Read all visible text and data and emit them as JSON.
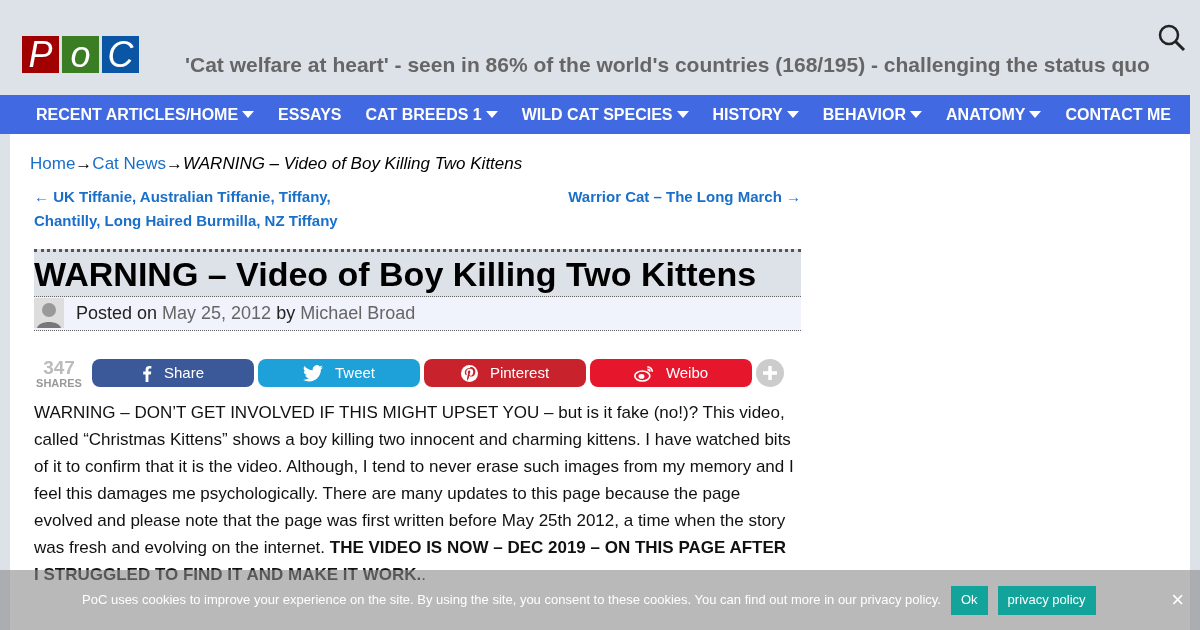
{
  "header": {
    "logo_letters": [
      "P",
      "o",
      "C"
    ],
    "tagline": "'Cat welfare at heart' - seen in 86% of the world's countries (168/195) - challenging the status quo"
  },
  "nav": [
    {
      "label": "RECENT ARTICLES/HOME",
      "has_submenu": true
    },
    {
      "label": "ESSAYS",
      "has_submenu": false
    },
    {
      "label": "CAT BREEDS 1",
      "has_submenu": true
    },
    {
      "label": "WILD CAT SPECIES",
      "has_submenu": true
    },
    {
      "label": "HISTORY",
      "has_submenu": true
    },
    {
      "label": "BEHAVIOR",
      "has_submenu": true
    },
    {
      "label": "ANATOMY",
      "has_submenu": true
    },
    {
      "label": "CONTACT ME",
      "has_submenu": false
    }
  ],
  "breadcrumb": {
    "links": [
      "Home",
      "Cat News"
    ],
    "separator": "→",
    "current": "WARNING – Video of Boy Killing Two Kittens"
  },
  "post_nav": {
    "previous": "← UK Tiffanie, Australian Tiffanie, Tiffany, Chantilly, Long Haired Burmilla, NZ Tiffany",
    "next": "Warrior Cat – The Long March →"
  },
  "article": {
    "title": "WARNING – Video of Boy Killing Two Kittens",
    "posted_on": "Posted on",
    "date": "May 25, 2012",
    "by": "by",
    "author": "Michael Broad",
    "share_count": "347",
    "share_label": "SHARES",
    "share_buttons": [
      {
        "kind": "facebook",
        "label": "Share",
        "color": "#3b5998"
      },
      {
        "kind": "twitter",
        "label": "Tweet",
        "color": "#1da1d8"
      },
      {
        "kind": "pinterest",
        "label": "Pinterest",
        "color": "#c8232c"
      },
      {
        "kind": "weibo",
        "label": "Weibo",
        "color": "#e6162d"
      }
    ],
    "body": "WARNING – DON’T GET INVOLVED IF THIS MIGHT UPSET YOU – but is it fake (no!)? This video, called “Christmas Kittens” shows a boy killing two innocent and charming kittens. I have watched bits of it to confirm that it is the video. Although, I tend to never erase such images from my memory and I feel this damages me psychologically. There are many updates to this page because the page evolved and please note that the page was first written before May 25th 2012, a time when the story was fresh and evolving on the internet. **THE VIDEO IS NOW – DEC 2019 – ON THIS PAGE AFTER I STRUGGLED TO FIND IT AND MAKE IT WORK.**."
  },
  "cookie_bar": {
    "text": "PoC uses cookies to improve your experience on the site. By using the site, you consent to these cookies. You can find out more in our privacy policy.",
    "buttons": [
      "Ok",
      "privacy policy"
    ],
    "close": "×"
  }
}
